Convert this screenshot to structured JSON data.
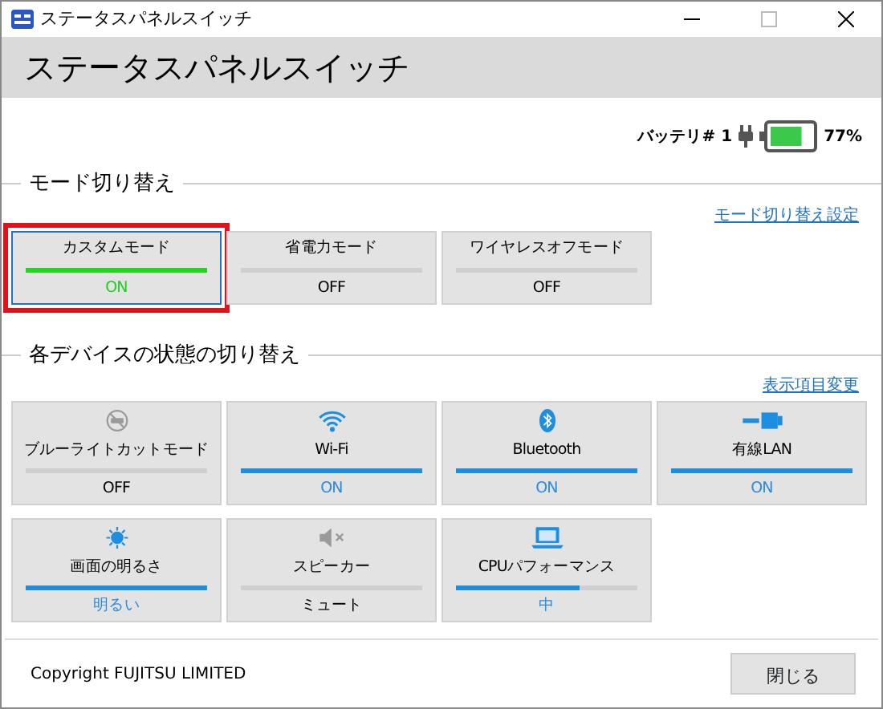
{
  "window": {
    "title": "ステータスパネルスイッチ"
  },
  "header": {
    "title": "ステータスパネルスイッチ"
  },
  "battery": {
    "label": "バッテリ# 1",
    "level": 0.77,
    "reading": "77%"
  },
  "mode_section": {
    "title": "モード切り替え",
    "link": "モード切り替え設定",
    "tiles": [
      {
        "label": "カスタムモード",
        "state": "ON",
        "selected": true
      },
      {
        "label": "省電力モード",
        "state": "OFF",
        "selected": false
      },
      {
        "label": "ワイヤレスオフモード",
        "state": "OFF",
        "selected": false
      }
    ]
  },
  "device_section": {
    "title": "各デバイスの状態の切り替え",
    "link": "表示項目変更",
    "tiles": [
      {
        "kind": "bluelight",
        "label": "ブルーライトカットモード",
        "state": "OFF",
        "on": false,
        "level": 0
      },
      {
        "kind": "wifi",
        "label": "Wi-Fi",
        "state": "ON",
        "on": true,
        "level": 1
      },
      {
        "kind": "bluetooth",
        "label": "Bluetooth",
        "state": "ON",
        "on": true,
        "level": 1
      },
      {
        "kind": "lan",
        "label": "有線LAN",
        "state": "ON",
        "on": true,
        "level": 1
      },
      {
        "kind": "brightness",
        "label": "画面の明るさ",
        "state": "明るい",
        "on": true,
        "level": 1
      },
      {
        "kind": "speaker",
        "label": "スピーカー",
        "state": "ミュート",
        "on": false,
        "level": 0
      },
      {
        "kind": "cpu",
        "label": "CPUパフォーマンス",
        "state": "中",
        "on": true,
        "level": 0.68
      }
    ]
  },
  "footer": {
    "copyright": "Copyright FUJITSU LIMITED",
    "close_button": "閉じる"
  }
}
